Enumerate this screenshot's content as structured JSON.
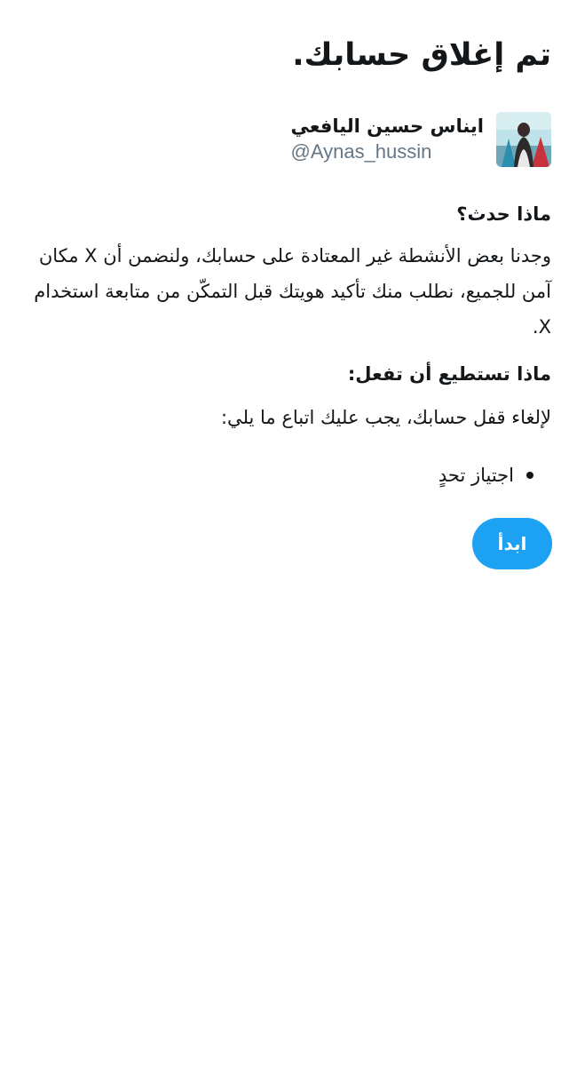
{
  "header": {
    "title": "تم إغلاق حسابك."
  },
  "account": {
    "display_name": "ايناس حسين اليافعي",
    "handle": "@Aynas_hussin",
    "avatar_icon": "profile-photo"
  },
  "what_happened": {
    "heading": "ماذا حدث؟",
    "body": "وجدنا بعض الأنشطة غير المعتادة على حسابك، ولنضمن أن X مكان آمن للجميع، نطلب منك تأكيد هويتك قبل التمكّن من متابعة استخدام X."
  },
  "what_to_do": {
    "heading": "ماذا تستطيع أن تفعل:",
    "body": "لإلغاء قفل حسابك، يجب عليك اتباع ما يلي:",
    "steps": [
      "اجتياز تحدٍ"
    ]
  },
  "actions": {
    "start_label": "ابدأ"
  },
  "colors": {
    "accent": "#1da1f2",
    "text_primary": "#14171a",
    "text_secondary": "#657786",
    "background": "#ffffff"
  }
}
